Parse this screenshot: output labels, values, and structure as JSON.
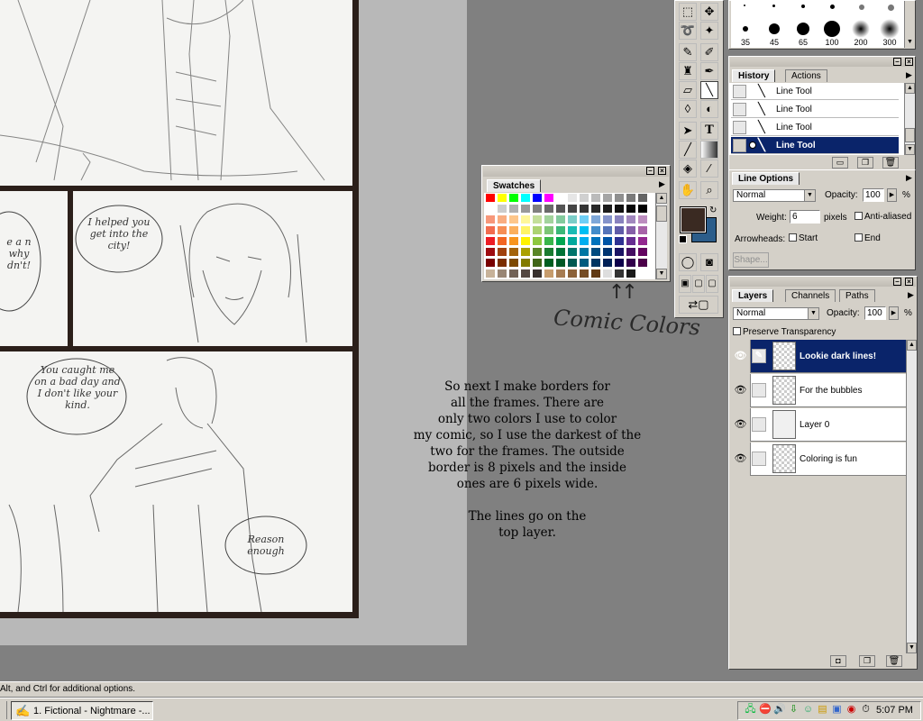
{
  "canvas": {
    "bubble_1": "I helped you get into the city!",
    "bubble_2": "You caught me on a bad day and I don't like your kind.",
    "bubble_3": "Reason enough",
    "bubble_partial": "e a n why dn't!"
  },
  "swatches": {
    "title": "Swatches",
    "colors_row0": [
      "#ff0000",
      "#ffff00",
      "#00ff00",
      "#00ffff",
      "#0000ff",
      "#ff00ff",
      "#ffffff",
      "#e6e6e6",
      "#d0d0d0",
      "#bbbbbb",
      "#a5a5a5",
      "#8f8f8f",
      "#7a7a7a",
      "#646464"
    ],
    "colors_row1": [
      "#ffffff",
      "#cccccc",
      "#b0b0b0",
      "#999999",
      "#808080",
      "#6a6a6a",
      "#555555",
      "#444444",
      "#353535",
      "#282828",
      "#1c1c1c",
      "#101010",
      "#080808",
      "#000000"
    ],
    "colors_row2": [
      "#f7977a",
      "#f9ad81",
      "#fdc68a",
      "#fff79a",
      "#c4df9b",
      "#a2d39c",
      "#82ca9d",
      "#7bcdc8",
      "#6ecff6",
      "#7ea7d8",
      "#8493ca",
      "#8882be",
      "#a187be",
      "#bc8dbf"
    ],
    "colors_row3": [
      "#f26c4f",
      "#f68e55",
      "#fbaf5c",
      "#fff467",
      "#acd372",
      "#7cc576",
      "#3bb878",
      "#1abbb4",
      "#00bff3",
      "#438cca",
      "#5574b9",
      "#605ca8",
      "#855fa8",
      "#a763a8"
    ],
    "colors_row4": [
      "#ed1c24",
      "#f26522",
      "#f7941d",
      "#fff200",
      "#8dc73f",
      "#39b54a",
      "#00a651",
      "#00a99d",
      "#00aeef",
      "#0072bc",
      "#0054a6",
      "#2e3192",
      "#662d91",
      "#92278f"
    ],
    "colors_row5": [
      "#9e0b0f",
      "#a0410d",
      "#a36209",
      "#aba000",
      "#598527",
      "#1a7b30",
      "#007236",
      "#00746b",
      "#0076a3",
      "#004b80",
      "#003471",
      "#1b1464",
      "#440e62",
      "#630460"
    ],
    "colors_row6": [
      "#790000",
      "#7b2e00",
      "#7d4900",
      "#827b00",
      "#406618",
      "#005e20",
      "#005826",
      "#005952",
      "#005b7f",
      "#003663",
      "#002157",
      "#0d004c",
      "#32004b",
      "#4b0049"
    ],
    "colors_row7": [
      "#c7b299",
      "#998675",
      "#736357",
      "#534741",
      "#37302d",
      "#c69c6d",
      "#a67c52",
      "#8c6239",
      "#754c24",
      "#603913",
      "#dddddd",
      "#333333",
      "#1a1a1a",
      "#ffffff"
    ]
  },
  "annotation": {
    "arrows": "↑↑",
    "comic_colors": "Comic Colors"
  },
  "caption": {
    "line1": "So next I make borders for",
    "line2": "all the frames.  There are",
    "line3": "only two colors I use to color",
    "line4": "my comic, so I use the darkest of the",
    "line5": "two for the frames.  The outside",
    "line6": "border is 8 pixels and the inside",
    "line7": "ones are 6 pixels wide.",
    "line8": "The lines go on the",
    "line9": "top layer."
  },
  "brushes": {
    "sizes": [
      "35",
      "45",
      "65",
      "100",
      "200",
      "300"
    ]
  },
  "history": {
    "tab_history": "History",
    "tab_actions": "Actions",
    "items": [
      "Line Tool",
      "Line Tool",
      "Line Tool",
      "Line Tool"
    ]
  },
  "line_options": {
    "tab": "Line Options",
    "mode": "Normal",
    "opacity_label": "Opacity:",
    "opacity_value": "100",
    "pct": "%",
    "weight_label": "Weight:",
    "weight_value": "6",
    "pixels": "pixels",
    "anti_aliased": "Anti-aliased",
    "arrowheads": "Arrowheads:",
    "start": "Start",
    "end": "End",
    "shape": "Shape..."
  },
  "layers": {
    "tab_layers": "Layers",
    "tab_channels": "Channels",
    "tab_paths": "Paths",
    "mode": "Normal",
    "opacity_label": "Opacity:",
    "opacity_value": "100",
    "pct": "%",
    "preserve": "Preserve Transparency",
    "items": [
      "Lookie dark lines!",
      "For the bubbles",
      "Layer 0",
      "Coloring is fun"
    ]
  },
  "colors": {
    "foreground": "#3a2a22",
    "background": "#2c5d8a"
  },
  "status_bar": {
    "text": "Alt, and Ctrl for additional options."
  },
  "taskbar": {
    "task_label": "1. Fictional - Nightmare -...",
    "clock": "5:07 PM"
  }
}
